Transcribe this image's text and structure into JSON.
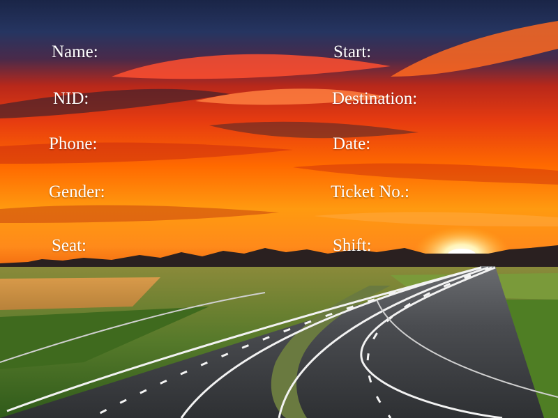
{
  "form": {
    "left_labels": {
      "name": "Name:",
      "nid": "NID:",
      "phone": "Phone:",
      "gender": "Gender:",
      "seat": "Seat:"
    },
    "right_labels": {
      "start": "Start:",
      "destination": "Destination:",
      "date": "Date:",
      "ticket_no": "Ticket No.:",
      "shift": "Shift:"
    }
  },
  "colors": {
    "label_text": "#ffffff",
    "sky_top": "#1c2a4f",
    "sky_glow": "#ff5a00",
    "sun": "#fff3b0",
    "grass": "#4d7a22",
    "road": "#3b3d40"
  }
}
